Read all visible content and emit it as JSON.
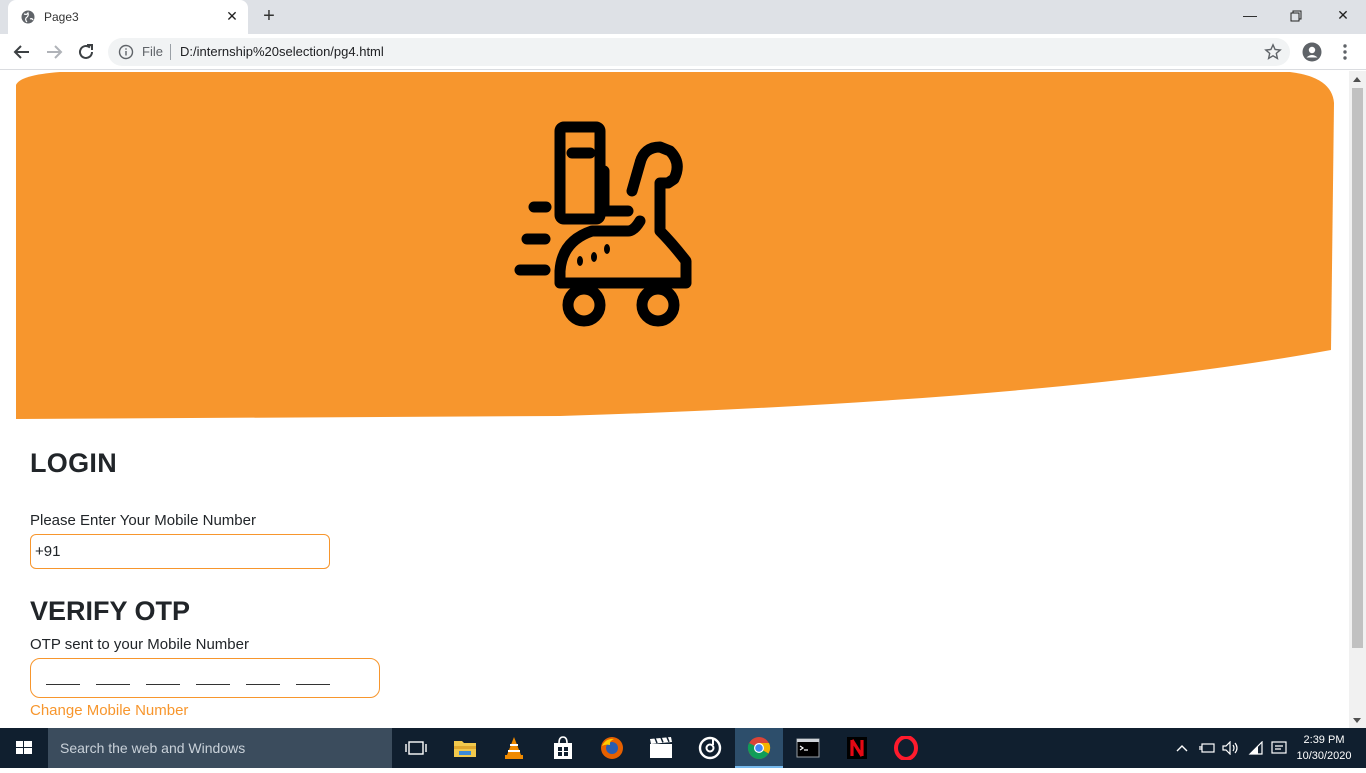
{
  "browser": {
    "tab_title": "Page3",
    "file_label": "File",
    "url": "D:/internship%20selection/pg4.html"
  },
  "page": {
    "hero_color": "#f7962d",
    "login_heading": "LOGIN",
    "mobile_label": "Please Enter Your Mobile Number",
    "mobile_value": "+91",
    "verify_heading": "VERIFY OTP",
    "otp_label": "OTP sent to your Mobile Number",
    "change_link": "Change Mobile Number"
  },
  "taskbar": {
    "search_placeholder": "Search the web and Windows",
    "time": "2:39 PM",
    "date": "10/30/2020",
    "apps": [
      "task-view-icon",
      "file-explorer-icon",
      "vlc-icon",
      "store-icon",
      "firefox-icon",
      "movies-icon",
      "groove-music-icon",
      "chrome-icon",
      "terminal-icon",
      "netflix-icon",
      "opera-icon"
    ]
  }
}
